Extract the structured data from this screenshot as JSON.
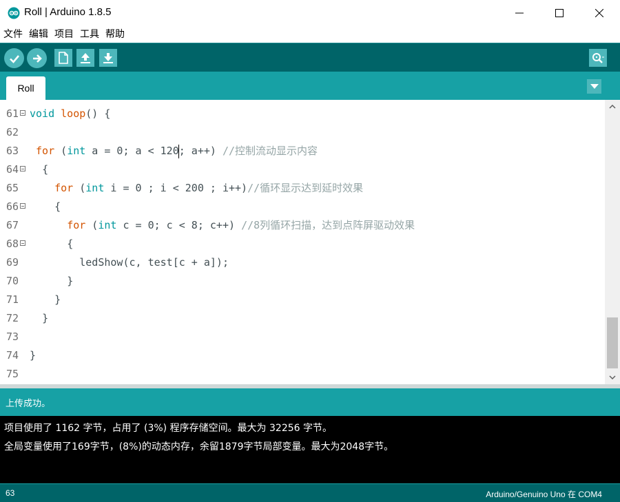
{
  "window": {
    "title": "Roll | Arduino 1.8.5"
  },
  "menu": [
    "文件",
    "编辑",
    "项目",
    "工具",
    "帮助"
  ],
  "toolbar": {
    "icons": [
      "verify-icon",
      "upload-icon",
      "new-icon",
      "open-icon",
      "save-icon",
      "serial-monitor-icon"
    ]
  },
  "tabs": [
    {
      "label": "Roll",
      "active": true
    }
  ],
  "editor": {
    "lines": [
      {
        "num": "61",
        "fold": true,
        "indent": "",
        "tokens": [
          {
            "t": "void",
            "c": "ty"
          },
          {
            "t": " "
          },
          {
            "t": "loop",
            "c": "kw"
          },
          {
            "t": "() {"
          }
        ]
      },
      {
        "num": "62",
        "fold": false,
        "indent": "",
        "tokens": []
      },
      {
        "num": "63",
        "fold": false,
        "indent": " ",
        "tokens": [
          {
            "t": "for",
            "c": "kw"
          },
          {
            "t": " ("
          },
          {
            "t": "int",
            "c": "ty"
          },
          {
            "t": " a = 0; a < 120"
          },
          {
            "caret": true
          },
          {
            "t": "; a++) "
          },
          {
            "t": "//控制流动显示内容",
            "c": "cm"
          }
        ]
      },
      {
        "num": "64",
        "fold": true,
        "indent": "  ",
        "tokens": [
          {
            "t": "{"
          }
        ]
      },
      {
        "num": "65",
        "fold": false,
        "indent": "    ",
        "tokens": [
          {
            "t": "for",
            "c": "kw"
          },
          {
            "t": " ("
          },
          {
            "t": "int",
            "c": "ty"
          },
          {
            "t": " i = 0 ; i < 200 ; i++)"
          },
          {
            "t": "//循环显示达到延时效果",
            "c": "cm"
          }
        ]
      },
      {
        "num": "66",
        "fold": true,
        "indent": "    ",
        "tokens": [
          {
            "t": "{"
          }
        ]
      },
      {
        "num": "67",
        "fold": false,
        "indent": "      ",
        "tokens": [
          {
            "t": "for",
            "c": "kw"
          },
          {
            "t": " ("
          },
          {
            "t": "int",
            "c": "ty"
          },
          {
            "t": " c = 0; c < 8; c++) "
          },
          {
            "t": "//8列循环扫描，达到点阵屏驱动效果",
            "c": "cm"
          }
        ]
      },
      {
        "num": "68",
        "fold": true,
        "indent": "      ",
        "tokens": [
          {
            "t": "{"
          }
        ]
      },
      {
        "num": "69",
        "fold": false,
        "indent": "        ",
        "tokens": [
          {
            "t": "ledShow(c, test[c + a]);"
          }
        ]
      },
      {
        "num": "70",
        "fold": false,
        "indent": "      ",
        "tokens": [
          {
            "t": "}"
          }
        ]
      },
      {
        "num": "71",
        "fold": false,
        "indent": "    ",
        "tokens": [
          {
            "t": "}"
          }
        ]
      },
      {
        "num": "72",
        "fold": false,
        "indent": "  ",
        "tokens": [
          {
            "t": "}"
          }
        ]
      },
      {
        "num": "73",
        "fold": false,
        "indent": "",
        "tokens": []
      },
      {
        "num": "74",
        "fold": false,
        "indent": "",
        "tokens": [
          {
            "t": "}"
          }
        ]
      },
      {
        "num": "75",
        "fold": false,
        "indent": "",
        "tokens": []
      }
    ]
  },
  "status": {
    "message": "上传成功。"
  },
  "console": {
    "lines": [
      "项目使用了 1162 字节，占用了 (3%) 程序存储空间。最大为 32256 字节。",
      "全局变量使用了169字节，(8%)的动态内存，余留1879字节局部变量。最大为2048字节。"
    ]
  },
  "footer": {
    "line_number": "63",
    "board_port": "Arduino/Genuino Uno 在 COM4"
  },
  "colors": {
    "toolbar_bg": "#006468",
    "tabbar_bg": "#17a1a5",
    "button_bg": "#4db7bb",
    "keyword": "#d35400",
    "type": "#00979c",
    "comment": "#95a5a6"
  }
}
